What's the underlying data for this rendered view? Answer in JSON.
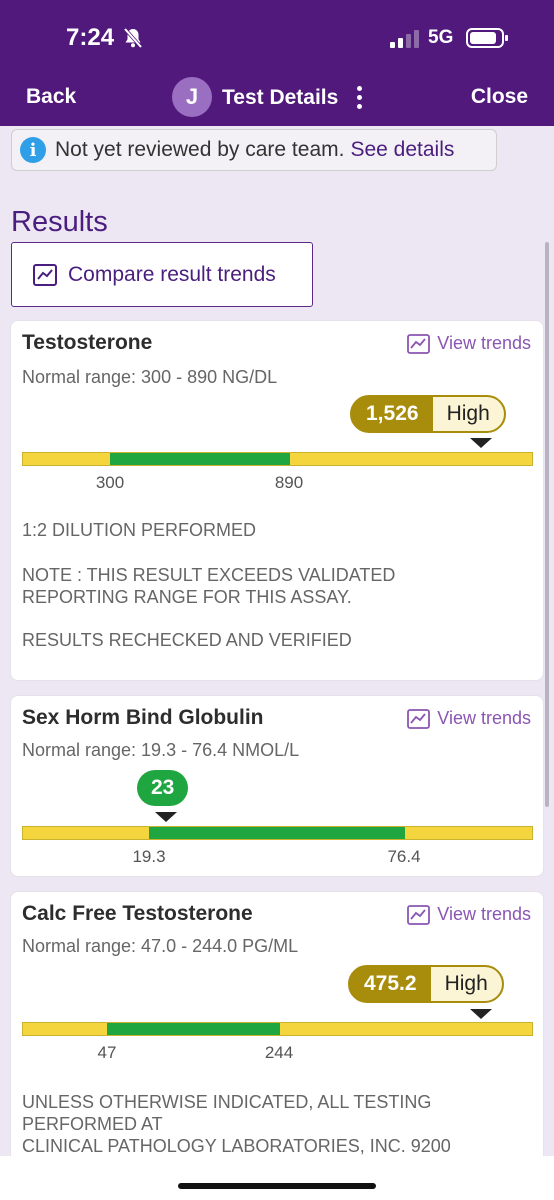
{
  "status": {
    "time": "7:24",
    "network": "5G"
  },
  "nav": {
    "back": "Back",
    "avatar_initial": "J",
    "title": "Test Details",
    "close": "Close"
  },
  "banner": {
    "text": "Not yet reviewed by care team.",
    "link": "See details"
  },
  "results": {
    "title": "Results",
    "compare_label": "Compare result trends",
    "cards": [
      {
        "title": "Testosterone",
        "trends_label": "View trends",
        "range": "Normal range: 300 - 890 NG/DL",
        "value": "1,526",
        "flag": "High",
        "tick_low": "300",
        "tick_high": "890",
        "notes": [
          "1:2 DILUTION PERFORMED",
          "NOTE : THIS RESULT EXCEEDS VALIDATED",
          "REPORTING RANGE FOR THIS ASSAY.",
          "RESULTS RECHECKED AND VERIFIED"
        ]
      },
      {
        "title": "Sex Horm Bind Globulin",
        "trends_label": "View trends",
        "range": "Normal range: 19.3 - 76.4 NMOL/L",
        "value": "23",
        "tick_low": "19.3",
        "tick_high": "76.4"
      },
      {
        "title": "Calc Free Testosterone",
        "trends_label": "View trends",
        "range": "Normal range: 47.0 - 244.0 PG/ML",
        "value": "475.2",
        "flag": "High",
        "tick_low": "47",
        "tick_high": "244",
        "notes": [
          "UNLESS OTHERWISE INDICATED, ALL TESTING",
          "PERFORMED AT",
          "CLINICAL PATHOLOGY LABORATORIES, INC. 9200"
        ]
      }
    ]
  },
  "colors": {
    "header": "#52197c",
    "accent": "#4a1e7e",
    "high": "#a88d0c",
    "normal": "#1fa640",
    "range_bar": "#f4d53d"
  }
}
